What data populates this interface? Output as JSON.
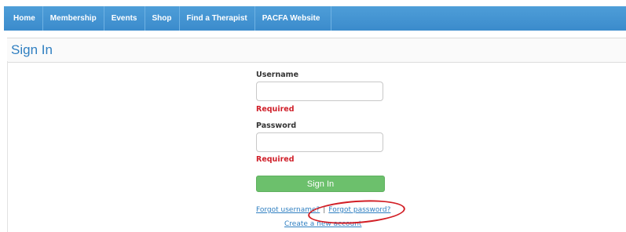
{
  "nav": {
    "items": [
      "Home",
      "Membership",
      "Events",
      "Shop",
      "Find a Therapist",
      "PACFA Website"
    ]
  },
  "page": {
    "title": "Sign In"
  },
  "form": {
    "username_label": "Username",
    "username_value": "",
    "username_error": "Required",
    "password_label": "Password",
    "password_value": "",
    "password_error": "Required",
    "signin_label": "Sign In"
  },
  "links": {
    "forgot_username": "Forgot username?",
    "separator": "|",
    "forgot_password": "Forgot password?",
    "create_account": "Create a new account"
  },
  "colors": {
    "nav_bar": "#3b8bcc",
    "title": "#2f7fc1",
    "error": "#d0202a",
    "signin_button": "#6cc06c",
    "annotation": "#d21f26"
  }
}
